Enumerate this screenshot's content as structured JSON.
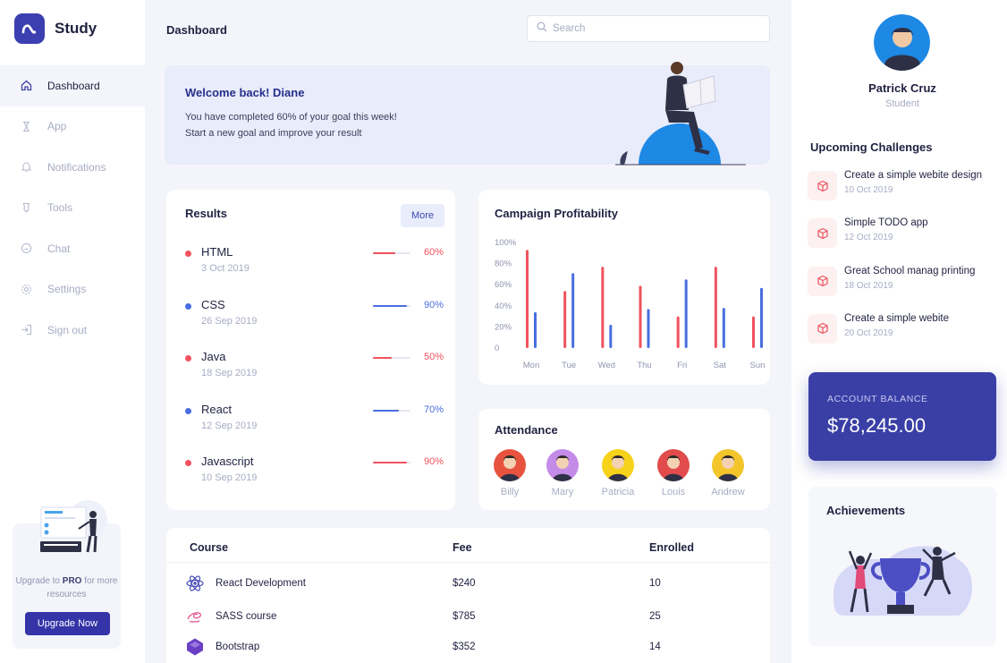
{
  "brand": {
    "name": "Study"
  },
  "sidebar": {
    "items": [
      {
        "label": "Dashboard",
        "icon": "home-icon",
        "active": true
      },
      {
        "label": "App",
        "icon": "app-icon"
      },
      {
        "label": "Notifications",
        "icon": "bell-icon"
      },
      {
        "label": "Tools",
        "icon": "tools-icon"
      },
      {
        "label": "Chat",
        "icon": "chat-icon"
      },
      {
        "label": "Settings",
        "icon": "gear-icon"
      },
      {
        "label": "Sign out",
        "icon": "signout-icon"
      }
    ],
    "promo": {
      "text_before": "Upgrade to ",
      "text_bold": "PRO",
      "text_after": " for more resources",
      "button": "Upgrade Now"
    }
  },
  "header": {
    "title": "Dashboard",
    "search_placeholder": "Search"
  },
  "welcome": {
    "title": "Welcome back! Diane",
    "line1": "You have completed 60% of your goal this week!",
    "line2": "Start a new goal and improve your result"
  },
  "results": {
    "title": "Results",
    "more_label": "More",
    "items": [
      {
        "name": "HTML",
        "date": "3 Oct 2019",
        "percent": "60%",
        "value": 60,
        "color": "#f0525e"
      },
      {
        "name": "CSS",
        "date": "26 Sep 2019",
        "percent": "90%",
        "value": 90,
        "color": "#4a6ee0"
      },
      {
        "name": "Java",
        "date": "18 Sep 2019",
        "percent": "50%",
        "value": 50,
        "color": "#f0525e"
      },
      {
        "name": "React",
        "date": "12 Sep 2019",
        "percent": "70%",
        "value": 70,
        "color": "#4a6ee0"
      },
      {
        "name": "Javascript",
        "date": "10 Sep 2019",
        "percent": "90%",
        "value": 90,
        "color": "#f0525e"
      }
    ]
  },
  "chart_data": {
    "type": "bar",
    "title": "Campaign Profitability",
    "categories": [
      "Mon",
      "Tue",
      "Wed",
      "Thu",
      "Fri",
      "Sat",
      "Sun"
    ],
    "y_ticks": [
      "100%",
      "80%",
      "60%",
      "40%",
      "20%",
      "0"
    ],
    "ylim": [
      0,
      100
    ],
    "grid": false,
    "series": [
      {
        "values": [
          93,
          54,
          77,
          59,
          30,
          77,
          30
        ],
        "color": "#f0525e"
      },
      {
        "values": [
          34,
          71,
          22,
          37,
          65,
          38,
          57
        ],
        "color": "#4a6ee0"
      }
    ]
  },
  "attendance": {
    "title": "Attendance",
    "people": [
      {
        "name": "Billy",
        "bg": "#e8533f"
      },
      {
        "name": "Mary",
        "bg": "#c58be8"
      },
      {
        "name": "Patricia",
        "bg": "#f6d21a"
      },
      {
        "name": "Louis",
        "bg": "#e24b4b"
      },
      {
        "name": "Andrew",
        "bg": "#f3c52b"
      }
    ]
  },
  "table": {
    "headers": {
      "course": "Course",
      "fee": "Fee",
      "enrolled": "Enrolled"
    },
    "rows": [
      {
        "course": "React Development",
        "fee": "$240",
        "enrolled": "10",
        "icon": "react-icon"
      },
      {
        "course": "SASS course",
        "fee": "$785",
        "enrolled": "25",
        "icon": "sass-icon"
      },
      {
        "course": "Bootstrap",
        "fee": "$352",
        "enrolled": "14",
        "icon": "bootstrap-icon"
      }
    ]
  },
  "profile": {
    "name": "Patrick Cruz",
    "role": "Student"
  },
  "challenges": {
    "title": "Upcoming Challenges",
    "items": [
      {
        "title": "Create a simple webite design",
        "date": "10 Oct 2019"
      },
      {
        "title": "Simple TODO app",
        "date": "12 Oct 2019"
      },
      {
        "title": "Great School manag printing",
        "date": "18 Oct 2019"
      },
      {
        "title": "Create a simple webite",
        "date": "20 Oct 2019"
      }
    ]
  },
  "balance": {
    "label": "ACCOUNT BALANCE",
    "value": "$78,245.00"
  },
  "achievements": {
    "title": "Achievements"
  },
  "colors": {
    "accent": "#3a3fa6",
    "red": "#f0525e",
    "blue": "#4a6ee0"
  }
}
